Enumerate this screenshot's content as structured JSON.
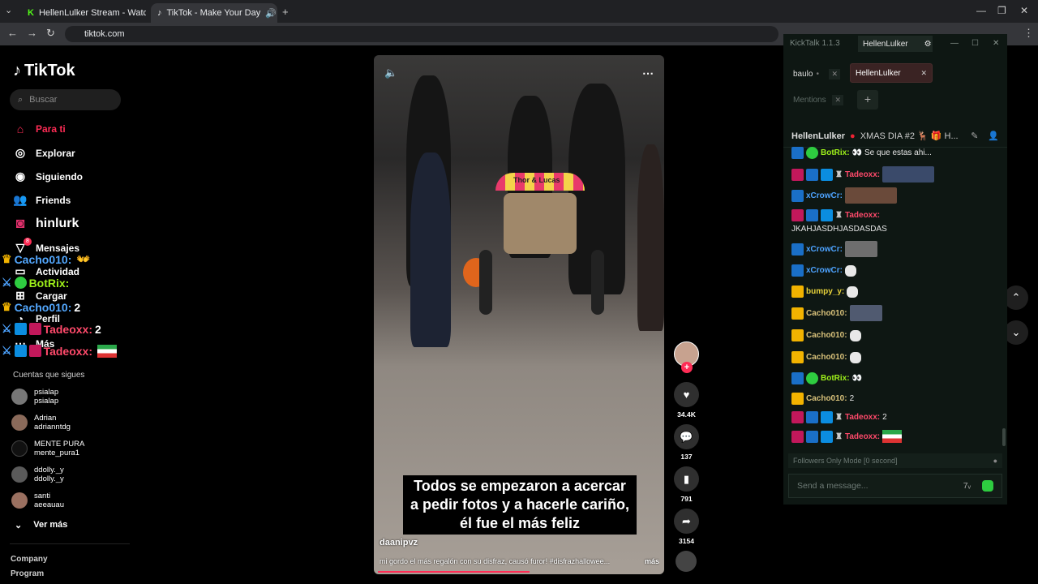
{
  "browser": {
    "tabs": [
      {
        "label": "HellenLulker Stream - Watch Li"
      },
      {
        "label": "TikTok - Make Your Day"
      }
    ],
    "url": "tiktok.com"
  },
  "sidebar": {
    "logo": "TikTok",
    "search_placeholder": "Buscar",
    "nav": [
      {
        "label": "Para ti",
        "icon": "home-icon"
      },
      {
        "label": "Explorar",
        "icon": "compass-icon"
      },
      {
        "label": "Siguiendo",
        "icon": "following-icon"
      },
      {
        "label": "Friends",
        "icon": "friends-icon"
      },
      {
        "label": "hinlurk",
        "icon": "instagram-icon"
      },
      {
        "label": "Mensajes",
        "icon": "message-icon"
      },
      {
        "label": "Actividad",
        "icon": "activity-icon"
      },
      {
        "label": "Cargar",
        "icon": "upload-icon"
      },
      {
        "label": "Perfil",
        "icon": "profile-icon"
      },
      {
        "label": "Más",
        "icon": "more-icon"
      }
    ],
    "message_badge": "8",
    "overlay": [
      {
        "name": "Cacho010:",
        "text": ""
      },
      {
        "name": "BotRix:",
        "text": ""
      },
      {
        "name": "Cacho010:",
        "text": "2"
      },
      {
        "name": "Tadeoxx:",
        "text": "2"
      },
      {
        "name": "Tadeoxx:",
        "text": ""
      }
    ],
    "following_title": "Cuentas que sigues",
    "following": [
      {
        "name": "psialap",
        "handle": "psialap"
      },
      {
        "name": "Adrian",
        "handle": "adrianntdg"
      },
      {
        "name": "MENTE PURA",
        "handle": "mente_pura1"
      },
      {
        "name": "ddolly._y",
        "handle": "ddolly._y"
      },
      {
        "name": "santi",
        "handle": "aeeauau"
      }
    ],
    "see_more": "Ver más",
    "footer": [
      "Company",
      "Program"
    ]
  },
  "video": {
    "caption": "Todos se empezaron a acercar a pedir fotos y a hacerle cariño, él fue el más feliz",
    "cart_sign": "Thor & Lucas",
    "author": "daanipvz",
    "description": "mi gordo el más regalón con su disfraz, causó furor! #disfrazhallowee...",
    "more": "más",
    "progress": 0.53
  },
  "actions": {
    "likes": "34.4K",
    "comments": "137",
    "saves": "791",
    "shares": "3154"
  },
  "kicktalk": {
    "title": "KickTalk 1.1.3",
    "window_tab": "HellenLulker",
    "channels": [
      {
        "label": "baulo"
      },
      {
        "label": "HellenLulker"
      }
    ],
    "mentions": "Mentions",
    "header_name": "HellenLulker",
    "header_title": "XMAS DIA #2 🦌 🎁 H...",
    "messages": [
      {
        "name": "BotRix:",
        "text": "Se que estas ahi...",
        "kind": "botrix"
      },
      {
        "name": "Tadeoxx:",
        "text": "",
        "kind": "tadeo",
        "thumb": true
      },
      {
        "name": "xCrowCr:",
        "text": "",
        "kind": "crow",
        "thumb": true
      },
      {
        "name": "Tadeoxx:",
        "text": "",
        "kind": "tadeo"
      },
      {
        "name": "",
        "text": "JKAHJASDHJASDASDAS",
        "kind": "plain"
      },
      {
        "name": "xCrowCr:",
        "text": "",
        "kind": "crow",
        "thumb": true
      },
      {
        "name": "xCrowCr:",
        "text": "",
        "kind": "crow",
        "emote": true
      },
      {
        "name": "bumpy_y:",
        "text": "",
        "kind": "sub",
        "emote": true
      },
      {
        "name": "Cacho010:",
        "text": "",
        "kind": "sub",
        "thumb": true
      },
      {
        "name": "Cacho010:",
        "text": "",
        "kind": "sub",
        "emote": true
      },
      {
        "name": "Cacho010:",
        "text": "",
        "kind": "sub",
        "emote": true
      },
      {
        "name": "BotRix:",
        "text": "",
        "kind": "botrix"
      },
      {
        "name": "Cacho010:",
        "text": "2",
        "kind": "sub"
      },
      {
        "name": "Tadeoxx:",
        "text": "2",
        "kind": "tadeo"
      },
      {
        "name": "Tadeoxx:",
        "text": "",
        "kind": "tadeo",
        "flag": true
      }
    ],
    "followers_mode": "Followers Only Mode [0 second]",
    "input_placeholder": "Send a message..."
  }
}
